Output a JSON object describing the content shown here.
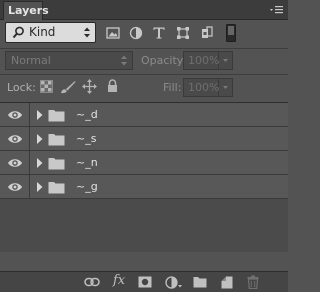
{
  "panel": {
    "tab_label": "Layers"
  },
  "filter": {
    "kind_label": "Kind",
    "icons": [
      "image-filter-icon",
      "adjustment-filter-icon",
      "type-filter-icon",
      "shape-filter-icon",
      "smart-object-filter-icon",
      "filter-toggle-switch"
    ]
  },
  "blend": {
    "mode_label": "Normal",
    "opacity_label": "Opacity:",
    "opacity_value": "100%"
  },
  "lock": {
    "label": "Lock:",
    "icons": [
      "lock-transparent-pixels-icon",
      "lock-image-pixels-icon",
      "lock-position-icon",
      "lock-all-icon"
    ],
    "fill_label": "Fill:",
    "fill_value": "100%"
  },
  "layers": [
    {
      "name": "~_d",
      "type": "group",
      "visible": true,
      "expanded": false
    },
    {
      "name": "~_s",
      "type": "group",
      "visible": true,
      "expanded": false
    },
    {
      "name": "~_n",
      "type": "group",
      "visible": true,
      "expanded": false
    },
    {
      "name": "~_g",
      "type": "group",
      "visible": true,
      "expanded": false
    }
  ],
  "bottom_bar": {
    "fx_label": "fx",
    "icons": [
      "link-layers-icon",
      "add-style-icon",
      "add-mask-icon",
      "new-adjustment-icon",
      "new-group-icon",
      "new-layer-icon",
      "delete-layer-icon"
    ]
  },
  "colors": {
    "panel_bg": "#535353",
    "title_bg": "#3c3c3c",
    "row_bg": "#585858",
    "list_bg": "#4b4b4b"
  }
}
